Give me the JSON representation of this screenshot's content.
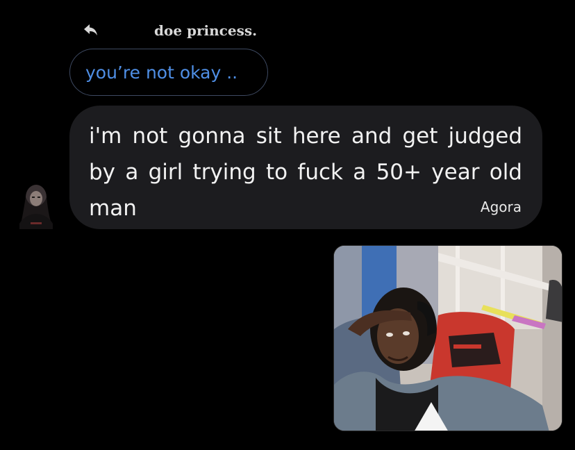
{
  "reply": {
    "icon": "reply-arrow-icon",
    "name": "doe princess."
  },
  "quoted_message": {
    "text": "you’re not okay .."
  },
  "message": {
    "text": "i'm not gonna sit here and get judged by a girl trying to fuck a 50+ year old man",
    "sender": "Agora"
  },
  "colors": {
    "background": "#000000",
    "bubble": "#1c1c1f",
    "quoted_text": "#4f8fe6",
    "quoted_border": "#3e4a62"
  }
}
